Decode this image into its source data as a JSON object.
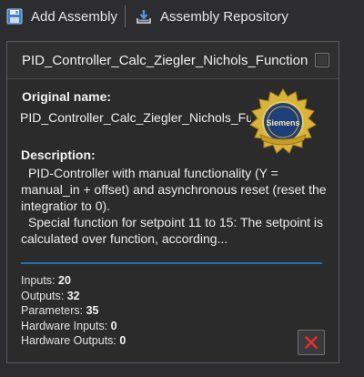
{
  "toolbar": {
    "add_assembly_label": "Add Assembly",
    "add_assembly_icon": "save-icon",
    "repository_label": "Assembly Repository",
    "repository_icon": "repository-download-icon"
  },
  "card": {
    "title": "PID_Controller_Calc_Ziegler_Nichols_Function",
    "original_name_label": "Original name:",
    "original_name_value": "PID_Controller_Calc_Ziegler_Nichols_Function",
    "badge_icon": "certified-seal-icon",
    "badge_text": "Siemens",
    "description_label": "Description:",
    "description_lines": [
      "PID-Controller with manual functionality (Y = manual_in + offset) and asynchronous reset (reset the integratior to 0).",
      "Special function for setpoint 11 to 15: The setpoint is calculated over function, according..."
    ],
    "stats": [
      {
        "label": "Inputs:",
        "value": "20"
      },
      {
        "label": "Outputs:",
        "value": "32"
      },
      {
        "label": "Parameters:",
        "value": "35"
      },
      {
        "label": "Hardware Inputs:",
        "value": "0"
      },
      {
        "label": "Hardware Outputs:",
        "value": "0"
      }
    ],
    "delete_icon": "close-x-icon"
  },
  "colors": {
    "background": "#2d2d30",
    "panel": "#2b2b2b",
    "divider_accent": "#1f6fb5",
    "delete_red": "#e0312e",
    "seal_gold": "#d9b43a",
    "seal_blue": "#1f3f7a"
  }
}
